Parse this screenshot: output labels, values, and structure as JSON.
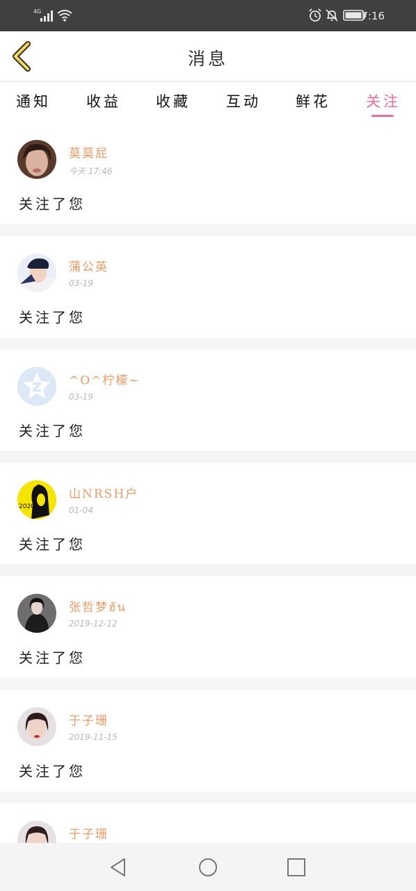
{
  "status_bar": {
    "network": "4G",
    "time": "7:16",
    "icons": [
      "signal-icon",
      "wifi-icon",
      "alarm-icon",
      "mute-bell-icon",
      "battery-icon"
    ]
  },
  "header": {
    "title": "消息",
    "back_icon": "chevron-left-icon"
  },
  "tabs": [
    {
      "label": "通知",
      "active": false
    },
    {
      "label": "收益",
      "active": false
    },
    {
      "label": "收藏",
      "active": false
    },
    {
      "label": "互动",
      "active": false
    },
    {
      "label": "鲜花",
      "active": false
    },
    {
      "label": "关注",
      "active": true
    }
  ],
  "messages": [
    {
      "name": "莫莫屁",
      "time": "今天 17:46",
      "text": "关注了您"
    },
    {
      "name": "蒲公英",
      "time": "03-19",
      "text": "关注了您"
    },
    {
      "name": "^O^柠檬~",
      "time": "03-19",
      "text": "关注了您"
    },
    {
      "name": "山NRSH户",
      "time": "01-04",
      "text": "关注了您"
    },
    {
      "name": "张哲梦ฮัน",
      "time": "2019-12-12",
      "text": "关注了您"
    },
    {
      "name": "于子珊",
      "time": "2019-11-15",
      "text": "关注了您"
    },
    {
      "name": "于子珊",
      "time": "",
      "text": ""
    }
  ],
  "avatars": {
    "avatar_3_text": "2020"
  },
  "colors": {
    "accent": "#e66c9b",
    "username": "#e69c6a",
    "status_bar": "#404040"
  }
}
